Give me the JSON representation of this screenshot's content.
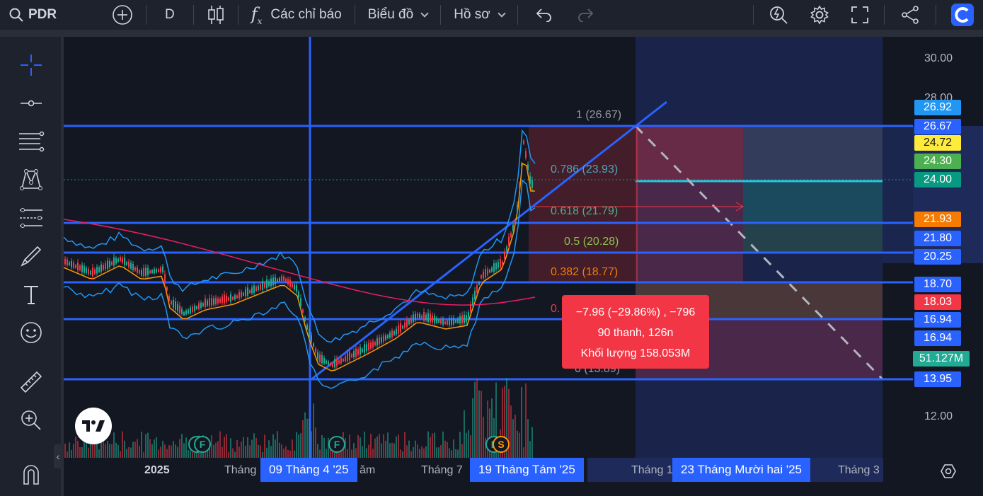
{
  "toolbar": {
    "symbol": "PDR",
    "interval": "D",
    "indicators": "Các chỉ báo",
    "chart_menu": "Biểu đồ",
    "profile_menu": "Hồ sơ"
  },
  "price_axis": {
    "ticks": [
      "30.00",
      "12.00"
    ],
    "partial_tick": "28.00",
    "labels": [
      {
        "text": "26.92",
        "color": "#2196f3"
      },
      {
        "text": "26.67",
        "color": "#2962ff"
      },
      {
        "text": "24.72",
        "color": "#ffeb3b"
      },
      {
        "text": "24.30",
        "color": "#4caf50"
      },
      {
        "text": "24.00",
        "color": "#089981"
      },
      {
        "text": "21.93",
        "color": "#f57c00"
      },
      {
        "text": "21.80",
        "color": "#2962ff"
      },
      {
        "text": "20.25",
        "color": "#2962ff"
      },
      {
        "text": "18.70",
        "color": "#2962ff"
      },
      {
        "text": "18.03",
        "color": "#f23645"
      },
      {
        "text": "16.94",
        "color": "#2962ff"
      },
      {
        "text": "16.94",
        "color": "#2962ff"
      },
      {
        "text": "51.127M",
        "color": "#22ab94"
      },
      {
        "text": "13.95",
        "color": "#2962ff"
      }
    ]
  },
  "time_axis": {
    "ticks": [
      "2025",
      "Tháng",
      "ăm",
      "Tháng 7",
      "Tháng 1",
      "Tháng 3"
    ],
    "selected": [
      "09 Tháng 4 '25",
      "19 Tháng Tám '25",
      "23 Tháng Mười hai '25"
    ]
  },
  "fib_levels": [
    {
      "text": "1 (26.67)",
      "color": "#9598a1"
    },
    {
      "text": "0.786 (23.93)",
      "color": "#4fa3b8"
    },
    {
      "text": "0.618 (21.79)",
      "color": "#4caf8a"
    },
    {
      "text": "0.5 (20.28)",
      "color": "#8bc34a"
    },
    {
      "text": "0.382 (18.77)",
      "color": "#f57c00"
    },
    {
      "text": "0.",
      "color": "#f23645"
    },
    {
      "text": "0 (13.89)",
      "color": "#9598a1"
    }
  ],
  "measure_tooltip": {
    "line1": "−7.96 (−29.86%) , −796",
    "line2": "90 thanh, 126n",
    "line3": "Khối lượng 158.053M"
  },
  "markers": [
    "F",
    "F",
    "S"
  ]
}
